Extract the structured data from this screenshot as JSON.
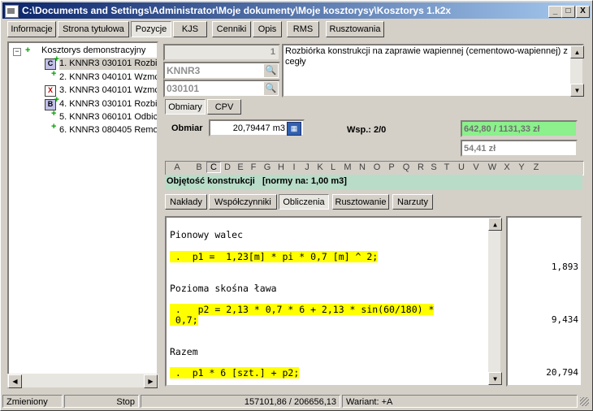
{
  "window": {
    "title": "C:\\Documents and Settings\\Administrator\\Moje dokumenty\\Moje kosztorysy\\Kosztorys 1.k2x",
    "minimize_label": "_",
    "maximize_label": "□",
    "close_label": "X"
  },
  "main_tabs": [
    "Informacje",
    "Strona tytułowa",
    "Pozycje",
    "KJS",
    "Cenniki",
    "Opis",
    "RMS",
    "Rusztowania"
  ],
  "active_main_tab": "Pozycje",
  "tree": {
    "root_label": "Kosztorys demonstracyjny",
    "items": [
      {
        "label": "1. KNNR3 030101 Rozbió",
        "icon": "C"
      },
      {
        "label": "2. KNNR3 040101 Wzmc",
        "icon": ""
      },
      {
        "label": "3. KNNR3 040101 Wzmc",
        "icon": "X"
      },
      {
        "label": "4. KNNR3 030101 Rozbió",
        "icon": "B"
      },
      {
        "label": "5. KNNR3 060101 Odbic",
        "icon": ""
      },
      {
        "label": "6. KNNR3 080405 Remo",
        "icon": ""
      }
    ]
  },
  "position": {
    "number": "1",
    "catalog": "KNNR3",
    "code": "030101",
    "description": "Rozbiórka konstrukcji na zaprawie wapiennej (cementowo-wapiennej) z cegły"
  },
  "upper_tabs": [
    "Obmiary",
    "CPV"
  ],
  "obmiar": {
    "label": "Obmiar",
    "value": "20,79447 m3",
    "wsp_label": "Wsp.: 2/0",
    "price_total": "642,80 / 1131,33 zł",
    "price_unit": "54,41 zł"
  },
  "letters": [
    "A",
    "B",
    "C",
    "D",
    "E",
    "F",
    "G",
    "H",
    "I",
    "J",
    "K",
    "L",
    "M",
    "N",
    "O",
    "P",
    "Q",
    "R",
    "S",
    "T",
    "U",
    "V",
    "W",
    "X",
    "Y",
    "Z"
  ],
  "active_letter": "C",
  "volume_header": "Objętość konstrukcji   [normy na: 1,00 m3]",
  "lower_tabs": [
    "Nakłady",
    "Współczynniki",
    "Obliczenia",
    "Rusztowanie",
    "Narzuty"
  ],
  "active_lower_tab": "Obliczenia",
  "calculations": {
    "heading1": "Pionowy walec",
    "expr1": " .  p1 =  1,23[m] * pi * 0,7 [m] ^ 2;",
    "heading2": "Pozioma skośna ława",
    "expr2a": " .   p2 = 2,13 * 0,7 * 6 + 2,13 * sin(60/180) *",
    "expr2b": " 0,7;",
    "heading3": "Razem",
    "expr3": " .  p1 * 6 [szt.] + p2;"
  },
  "results": [
    "1,893",
    "9,434",
    "20,794"
  ],
  "status": {
    "state": "Zmieniony",
    "action": "Stop",
    "totals": "157101,86 / 206656,13",
    "variant": "Wariant: +A"
  },
  "colors": {
    "highlight": "#ffff00",
    "price_green": "#8cf08c",
    "volume_bg": "#b8dcc8"
  }
}
